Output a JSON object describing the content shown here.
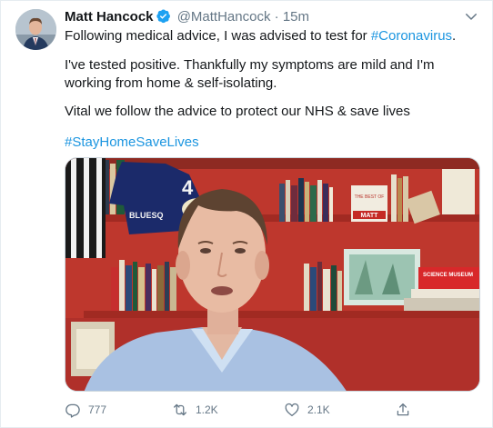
{
  "tweet": {
    "author_name": "Matt Hancock",
    "author_handle": "@MattHancock",
    "separator": "·",
    "time_ago": "15m",
    "line1_text": "Following medical advice, I was advised to test for ",
    "line1_hashtag": "#Coronavirus",
    "line1_end": ".",
    "paragraph2": "I've tested positive. Thankfully my symptoms are mild and I'm working from home & self-isolating.",
    "paragraph3": "Vital we follow the advice to protect our NHS & save lives",
    "hashtag2": "#StayHomeSaveLives",
    "verified_color": "#1da1f2",
    "hashtag_color": "#1b95e0"
  },
  "media": {
    "shirt_number": "4",
    "shirt_text": "BLUESQ",
    "book_title": "THE BEST OF",
    "book_name": "MATT",
    "museum_label": "SCIENCE MUSEUM"
  },
  "actions": {
    "reply_count": "777",
    "retweet_count": "1.2K",
    "like_count": "2.1K"
  },
  "icons": [
    "verified-icon",
    "caret-down-icon",
    "reply-icon",
    "retweet-icon",
    "like-icon",
    "share-icon"
  ]
}
